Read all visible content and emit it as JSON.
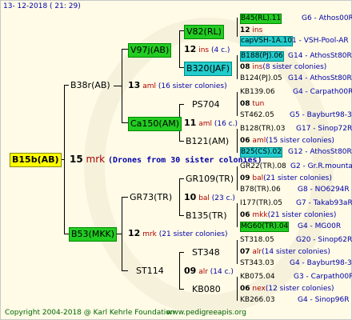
{
  "header": {
    "date": "13-  12-2018  (  21:  29)"
  },
  "root": {
    "name": "B15b(AB)",
    "num": "15",
    "mark": "mrk",
    "note": "(Drones from 30 sister colonies)"
  },
  "g1": [
    {
      "name": "B38r(AB)",
      "num": "13",
      "mark": "aml",
      "sis": "(16 sister colonies)"
    },
    {
      "name": "B53(MKK)",
      "num": "12",
      "mark": "mrk",
      "sis": "(21 sister colonies)"
    }
  ],
  "g2": [
    {
      "name": "V97j(AB)",
      "num": "12",
      "mark": "ins",
      "sis": "(4 c.)"
    },
    {
      "name": "Ca150(AM)",
      "num": "11",
      "mark": "aml",
      "sis": "(16 c.)"
    },
    {
      "name": "GR73(TR)",
      "num": "10",
      "mark": "bal",
      "sis": "(23 c.)"
    },
    {
      "name": "ST114",
      "num": "09",
      "mark": "alr",
      "sis": "(14 c.)"
    }
  ],
  "g3": [
    {
      "name": "V82(RL)",
      "num": "12",
      "mark": "ins",
      "sis": ""
    },
    {
      "name": "B320(JAF)",
      "num": "08",
      "mark": "ins",
      "sis": "(8 sister colonies)"
    },
    {
      "name": "PS704",
      "num": "08",
      "mark": "tun",
      "sis": ""
    },
    {
      "name": "B121(AM)",
      "num": "06",
      "mark": "aml",
      "sis": "(15 sister colonies)"
    },
    {
      "name": "GR109(TR)",
      "num": "09",
      "mark": "bal",
      "sis": "(21 sister colonies)"
    },
    {
      "name": "B135(TR)",
      "num": "06",
      "mark": "mkk",
      "sis": "(21 sister colonies)"
    },
    {
      "name": "ST348",
      "num": "07",
      "mark": "alr",
      "sis": "(14 sister colonies)"
    },
    {
      "name": "KB080",
      "num": "06",
      "mark": "nex",
      "sis": "(12 sister colonies)"
    }
  ],
  "g4": [
    {
      "name": "B45(RL).11",
      "loc": "G6 - Athos00R"
    },
    {
      "name": "capVSH-1A.10",
      "loc": "1 - VSH-Pool-AR"
    },
    {
      "name": "B188(PJ).06",
      "loc": "G14 - AthosSt80R"
    },
    {
      "name": "B124(PJ).05",
      "loc": "G14 - AthosSt80R"
    },
    {
      "name": "KB139.06",
      "loc": "G4 - Carpath00R"
    },
    {
      "name": "ST462.05",
      "loc": "G5 - Bayburt98-3"
    },
    {
      "name": "B128(TR).03",
      "loc": "G17 - Sinop72R"
    },
    {
      "name": "B25(CS).02",
      "loc": "G12 - AthosSt80R"
    },
    {
      "name": "GR22(TR).08",
      "loc": "G2 - Gr.R.mounta"
    },
    {
      "name": "B78(TR).06",
      "loc": "G8 - NO6294R"
    },
    {
      "name": "I177(TR).05",
      "loc": "G7 - Takab93aR"
    },
    {
      "name": "MG60(TR).04",
      "loc": "G4 - MG00R"
    },
    {
      "name": "ST318.05",
      "loc": "G20 - Sinop62R"
    },
    {
      "name": "ST343.03",
      "loc": "G4 - Bayburt98-3"
    },
    {
      "name": "KB075.04",
      "loc": "G3 - Carpath00R"
    },
    {
      "name": "KB266.03",
      "loc": "G4 - Sinop96R"
    }
  ],
  "footer": {
    "copyright": "Copyright 2004-2018 @ Karl Kehrle Foundation",
    "site": "www.pedigreeapis.org"
  }
}
